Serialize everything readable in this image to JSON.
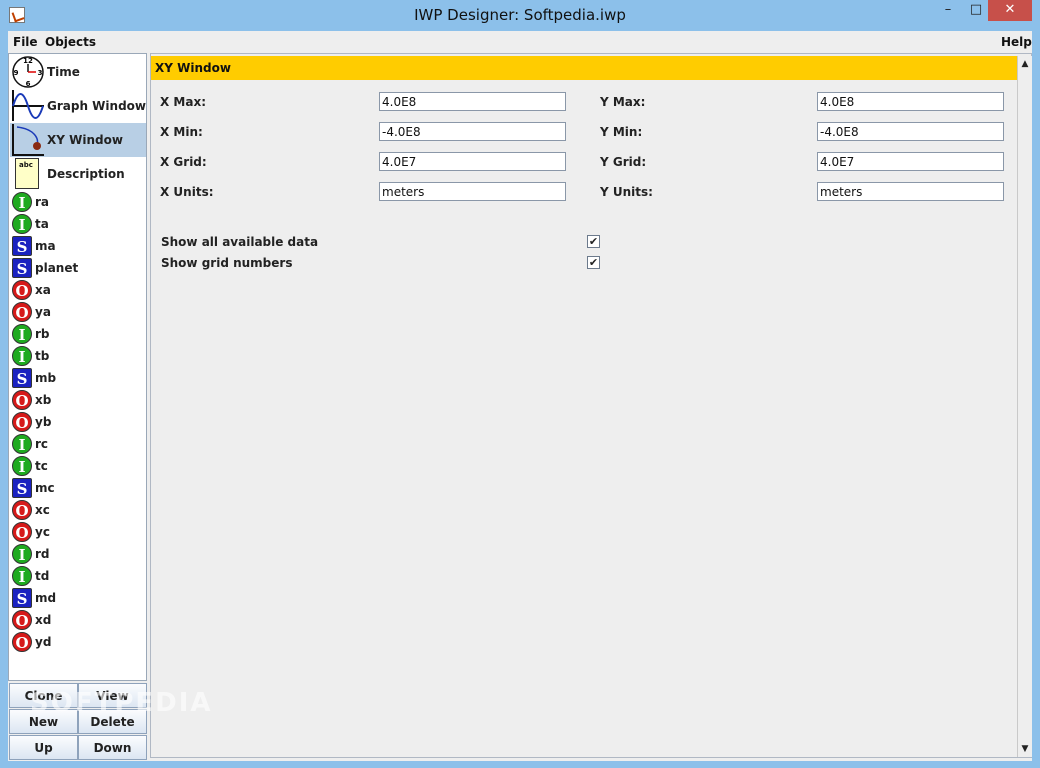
{
  "window": {
    "title": "IWP Designer: Softpedia.iwp",
    "min": "–",
    "max": "□",
    "close": "✕"
  },
  "menu": {
    "file": "File",
    "objects": "Objects",
    "help": "Help"
  },
  "objects": [
    {
      "label": "Time",
      "icon": "clock-icon"
    },
    {
      "label": "Graph Window",
      "icon": "sine-graph-icon"
    },
    {
      "label": "XY Window",
      "icon": "xy-trajectory-icon",
      "selected": true
    },
    {
      "label": "Description",
      "icon": "note-icon"
    }
  ],
  "clock_digits": {
    "n12": "12",
    "n3": "3",
    "n6": "6",
    "n9": "9"
  },
  "note_text": "abc",
  "variables": [
    {
      "type": "I",
      "name": "ra"
    },
    {
      "type": "I",
      "name": "ta"
    },
    {
      "type": "S",
      "name": "ma"
    },
    {
      "type": "S",
      "name": "planet"
    },
    {
      "type": "O",
      "name": "xa"
    },
    {
      "type": "O",
      "name": "ya"
    },
    {
      "type": "I",
      "name": "rb"
    },
    {
      "type": "I",
      "name": "tb"
    },
    {
      "type": "S",
      "name": "mb"
    },
    {
      "type": "O",
      "name": "xb"
    },
    {
      "type": "O",
      "name": "yb"
    },
    {
      "type": "I",
      "name": "rc"
    },
    {
      "type": "I",
      "name": "tc"
    },
    {
      "type": "S",
      "name": "mc"
    },
    {
      "type": "O",
      "name": "xc"
    },
    {
      "type": "O",
      "name": "yc"
    },
    {
      "type": "I",
      "name": "rd"
    },
    {
      "type": "I",
      "name": "td"
    },
    {
      "type": "S",
      "name": "md"
    },
    {
      "type": "O",
      "name": "xd"
    },
    {
      "type": "O",
      "name": "yd"
    }
  ],
  "buttons": {
    "clone": "Clone",
    "view": "View",
    "new": "New",
    "delete": "Delete",
    "up": "Up",
    "down": "Down"
  },
  "panel": {
    "title": "XY Window",
    "x_max_label": "X Max:",
    "x_max": "4.0E8",
    "x_min_label": "X Min:",
    "x_min": "-4.0E8",
    "x_grid_label": "X Grid:",
    "x_grid": "4.0E7",
    "x_units_label": "X Units:",
    "x_units": "meters",
    "y_max_label": "Y Max:",
    "y_max": "4.0E8",
    "y_min_label": "Y Min:",
    "y_min": "-4.0E8",
    "y_grid_label": "Y Grid:",
    "y_grid": "4.0E7",
    "y_units_label": "Y Units:",
    "y_units": "meters",
    "show_all_label": "Show all available data",
    "show_all_checked": true,
    "show_grid_label": "Show grid numbers",
    "show_grid_checked": true
  },
  "check_mark": "✔",
  "scroll": {
    "up": "▲",
    "down": "▼"
  },
  "watermark": "SOFTPEDIA",
  "colors": {
    "panel_header": "#ffcc00",
    "selection": "#b8cfe5",
    "input_badge": "#1faa20",
    "output_badge": "#d61a1a",
    "state_badge": "#1a22c0"
  }
}
